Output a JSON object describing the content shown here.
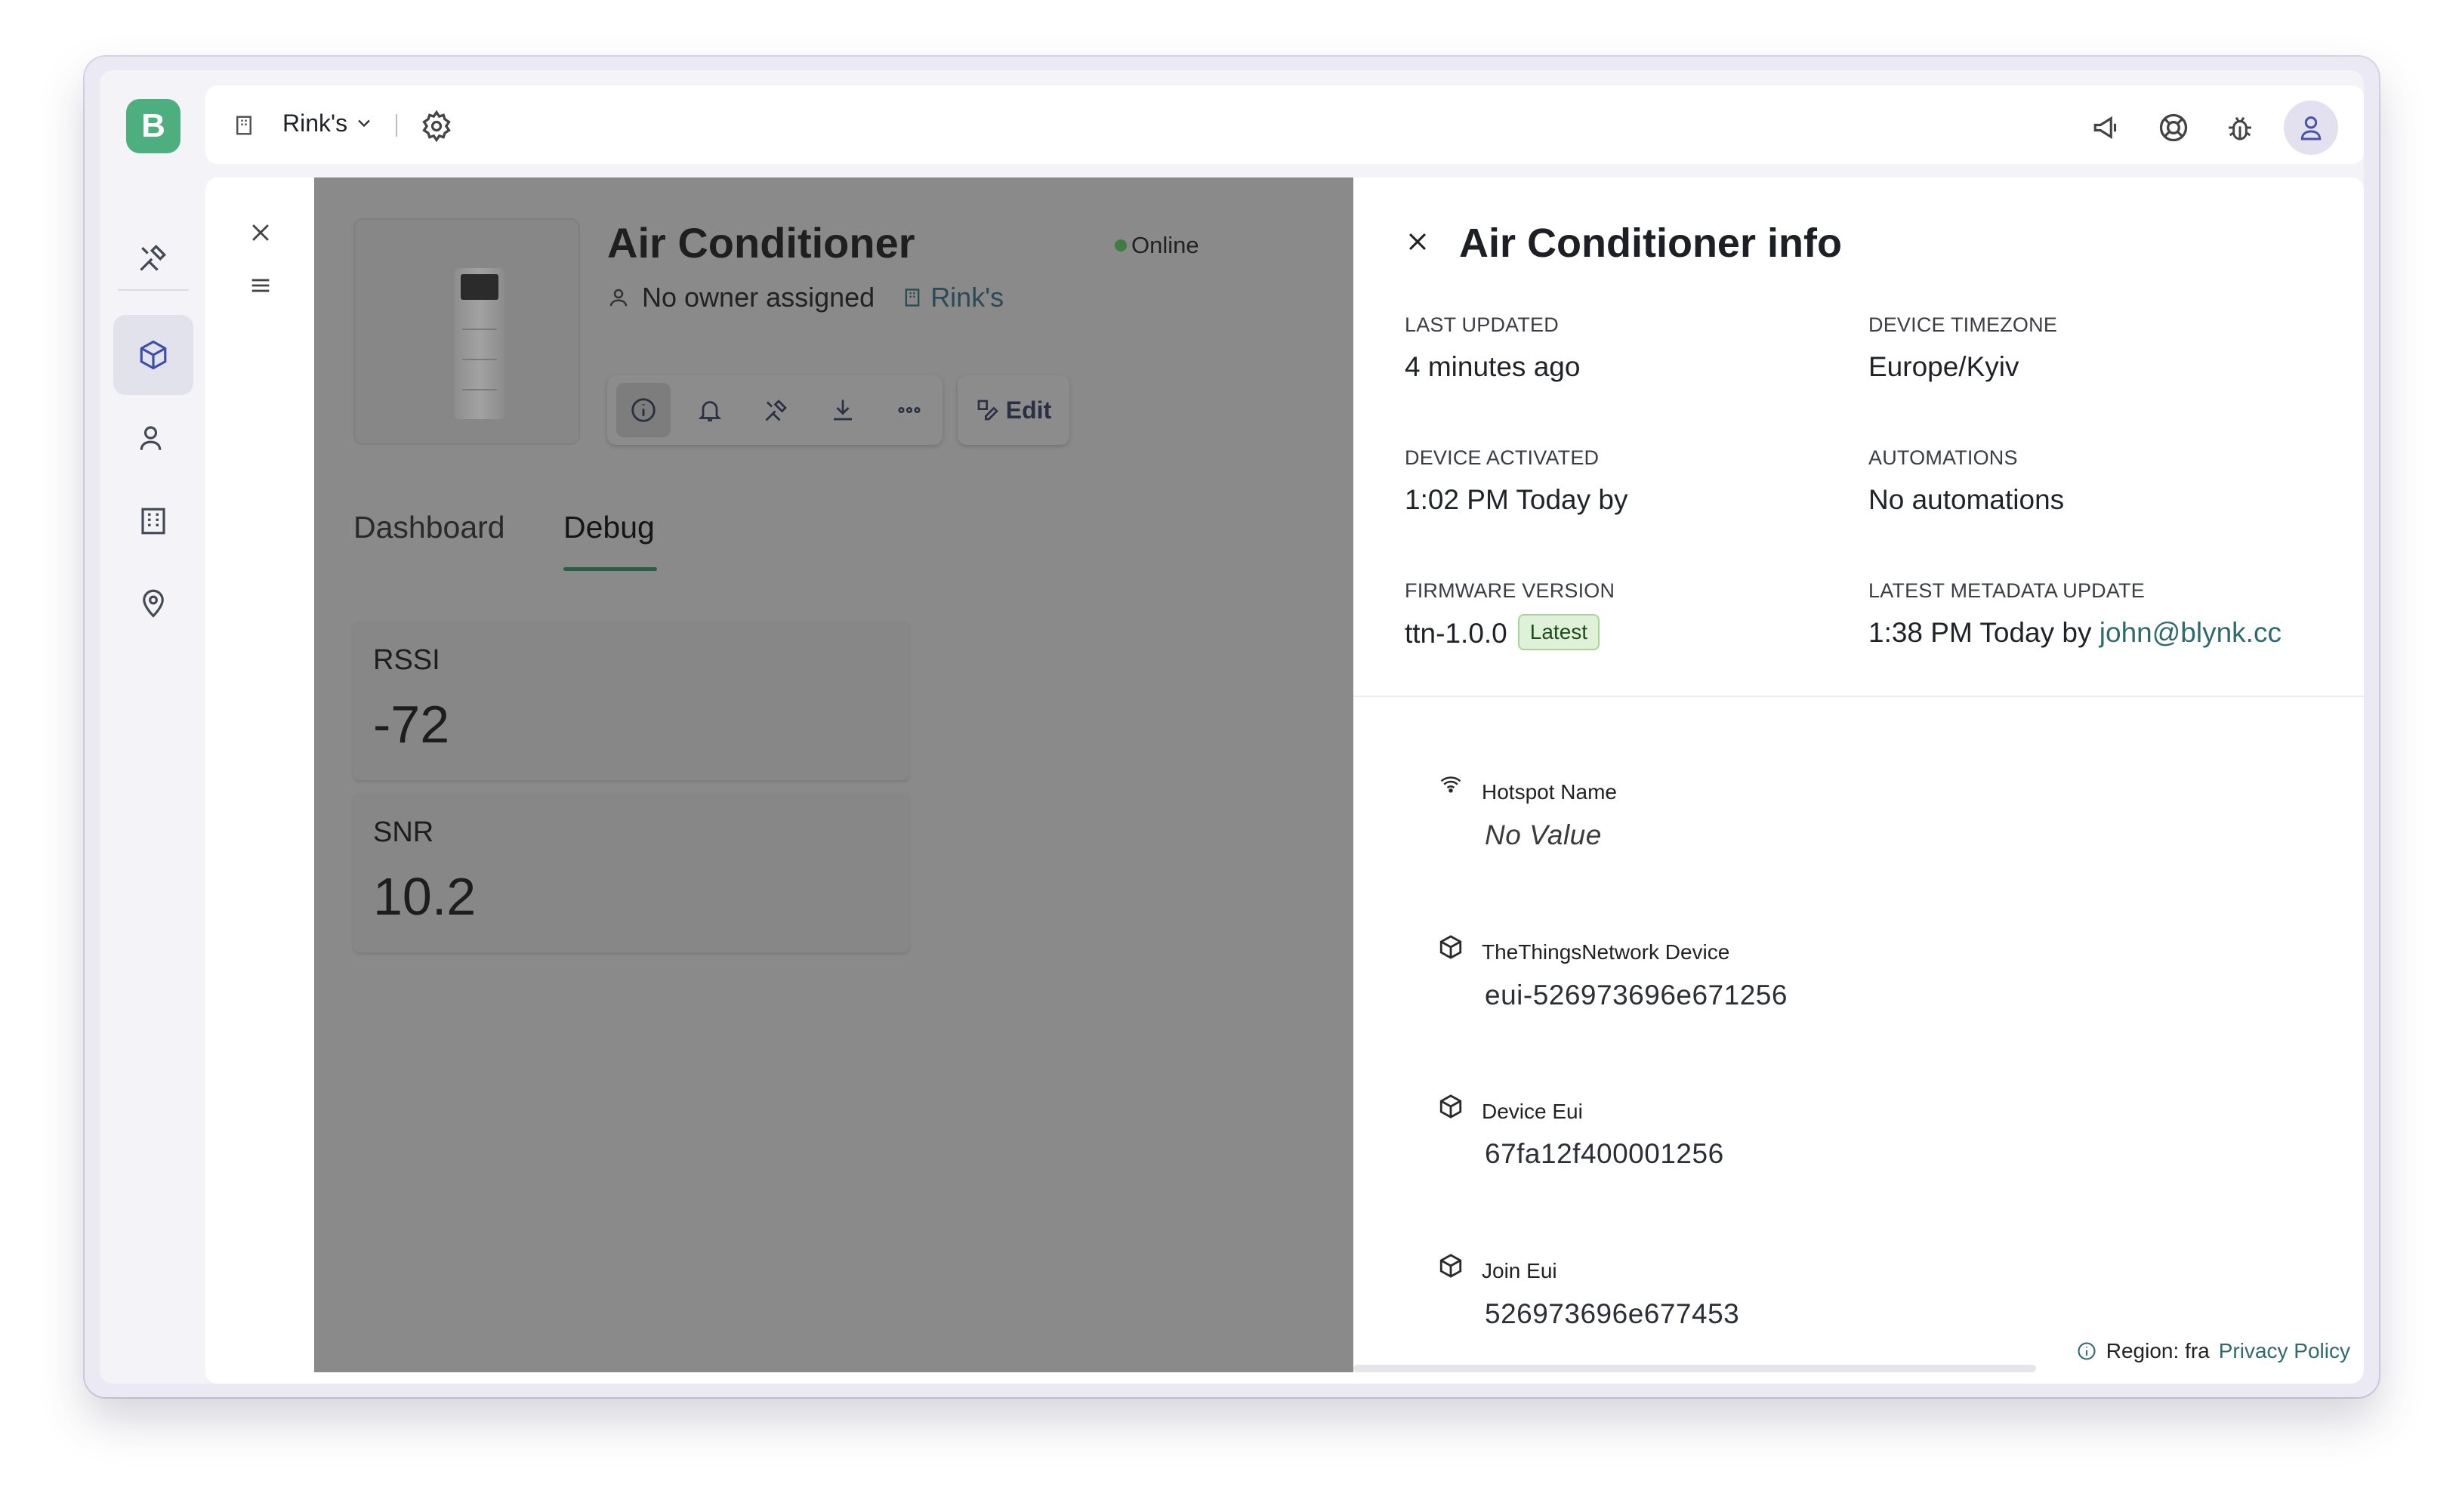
{
  "app": {
    "logo_letter": "B"
  },
  "topbar": {
    "org_name": "Rink's"
  },
  "device": {
    "name": "Air Conditioner",
    "status": "Online",
    "owner": "No owner assigned",
    "org": "Rink's",
    "edit_label": "Edit",
    "tabs": [
      {
        "label": "Dashboard"
      },
      {
        "label": "Debug"
      }
    ],
    "active_tab": "Debug",
    "metrics": [
      {
        "label": "RSSI",
        "value": "-72"
      },
      {
        "label": "SNR",
        "value": "10.2"
      }
    ]
  },
  "info_panel": {
    "title": "Air Conditioner info",
    "fields": {
      "last_updated_label": "LAST UPDATED",
      "last_updated": "4 minutes ago",
      "timezone_label": "DEVICE TIMEZONE",
      "timezone": "Europe/Kyiv",
      "activated_label": "DEVICE ACTIVATED",
      "activated": "1:02 PM Today by",
      "automations_label": "AUTOMATIONS",
      "automations": "No automations",
      "firmware_label": "FIRMWARE VERSION",
      "firmware": "ttn-1.0.0",
      "firmware_badge": "Latest",
      "metadata_label": "LATEST METADATA UPDATE",
      "metadata_time": "1:38 PM Today by",
      "metadata_user": "john@blynk.cc"
    },
    "datastreams": [
      {
        "label": "Hotspot Name",
        "value": "No Value",
        "icon": "wifi-icon"
      },
      {
        "label": "TheThingsNetwork Device",
        "value": "eui-526973696e671256",
        "icon": "cube-icon"
      },
      {
        "label": "Device Eui",
        "value": "67fa12f400001256",
        "icon": "cube-icon"
      },
      {
        "label": "Join Eui",
        "value": "526973696e677453",
        "icon": "cube-icon"
      }
    ]
  },
  "footer": {
    "region": "Region: fra",
    "privacy": "Privacy Policy"
  },
  "colors": {
    "accent": "#4caf7d",
    "link": "#2e6a6e",
    "online": "#3e7d3f"
  }
}
